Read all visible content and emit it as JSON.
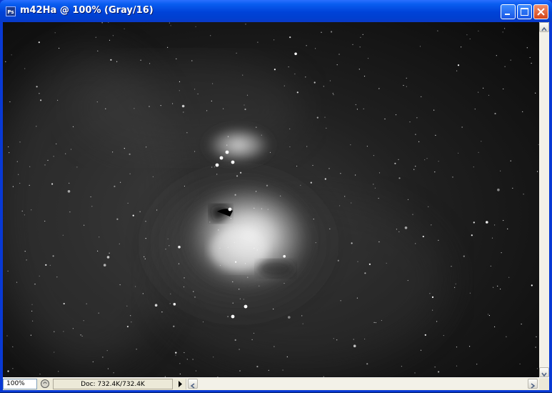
{
  "window": {
    "title": "m42Ha @ 100% (Gray/16)",
    "app_icon_text": "Ps",
    "accent": "#0a5ef0",
    "controls": [
      "minimize-icon",
      "maximize-icon",
      "close-icon"
    ]
  },
  "document": {
    "image_subject": "orion-nebula-grayscale"
  },
  "status": {
    "zoom": "100%",
    "doc_info": "Doc: 732.4K/732.4K",
    "info_icon": "status-info-icon",
    "menu_arrow": "triangle-right-icon"
  }
}
